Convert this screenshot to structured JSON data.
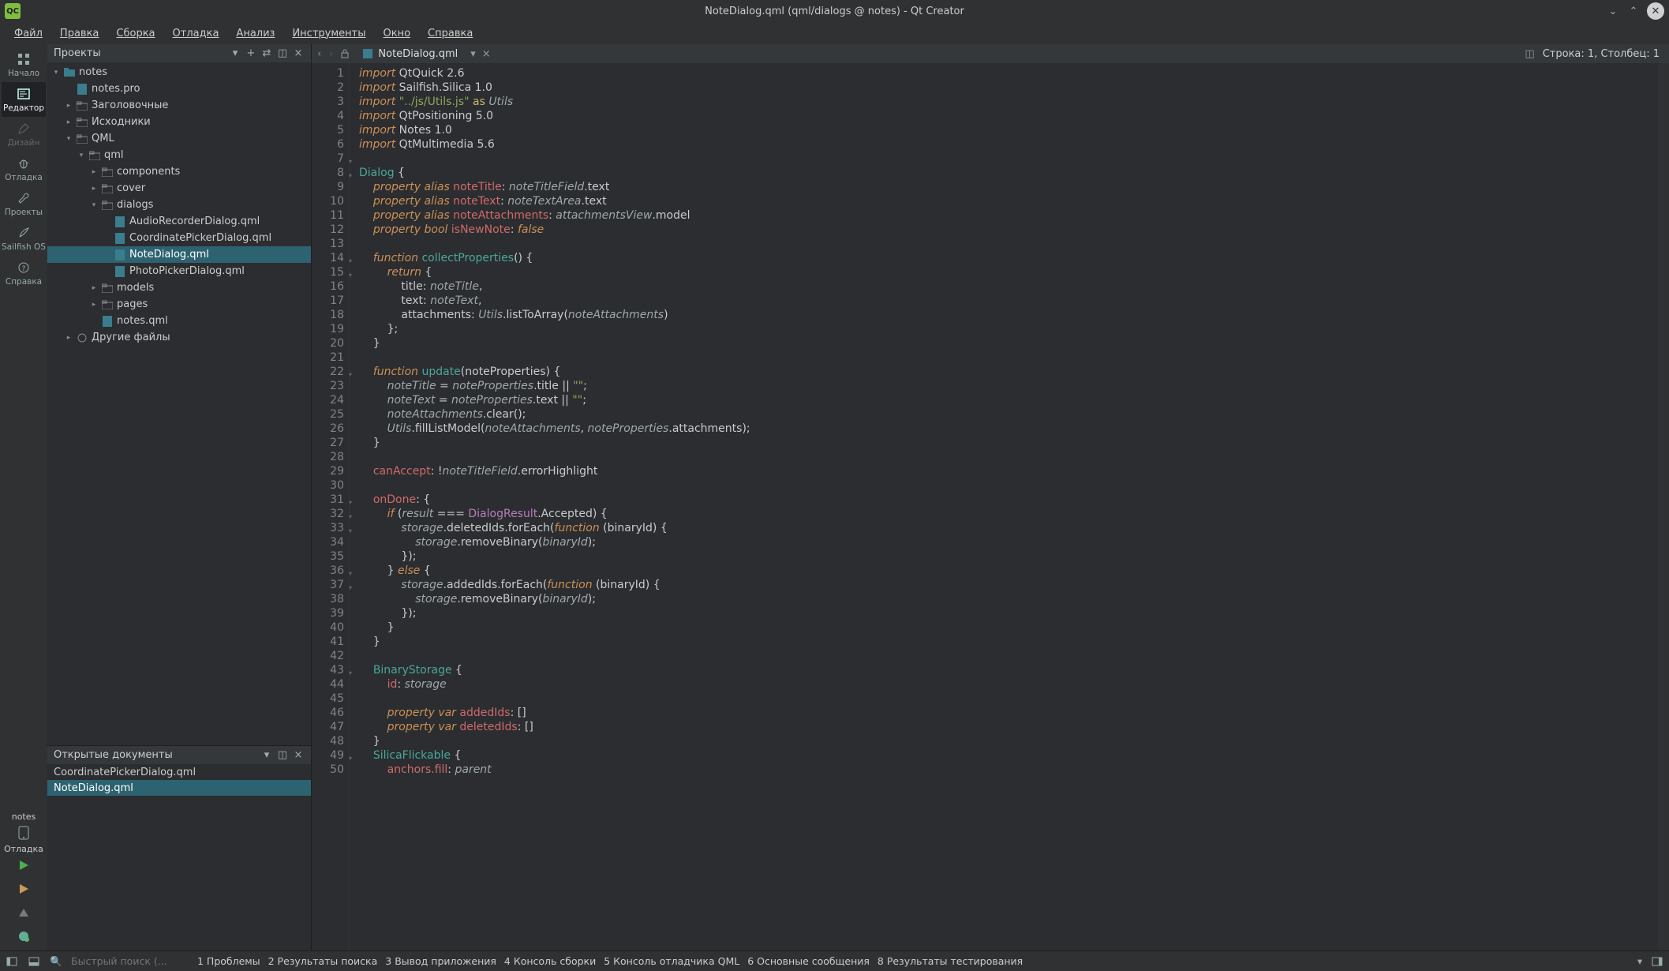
{
  "title": "NoteDialog.qml (qml/dialogs @ notes) - Qt Creator",
  "app_icon_text": "QC",
  "menu": {
    "file": "Файл",
    "edit": "Правка",
    "build": "Сборка",
    "debug": "Отладка",
    "analyze": "Анализ",
    "tools": "Инструменты",
    "window": "Окно",
    "help": "Справка"
  },
  "modes": {
    "start": "Начало",
    "edit": "Редактор",
    "design": "Дизайн",
    "debug": "Отладка",
    "projects": "Проекты",
    "sailfish": "Sailfish OS",
    "help": "Справка"
  },
  "kit": {
    "project": "notes",
    "config": "Отладка"
  },
  "projects_header": "Проекты",
  "opendocs_header": "Открытые документы",
  "tree": [
    {
      "d": 0,
      "a": "▾",
      "i": "proj",
      "t": "notes"
    },
    {
      "d": 1,
      "a": "",
      "i": "pro",
      "t": "notes.pro"
    },
    {
      "d": 1,
      "a": "▸",
      "i": "fold",
      "t": "Заголовочные"
    },
    {
      "d": 1,
      "a": "▸",
      "i": "fold",
      "t": "Исходники"
    },
    {
      "d": 1,
      "a": "▾",
      "i": "fold",
      "t": "QML"
    },
    {
      "d": 2,
      "a": "▾",
      "i": "dir",
      "t": "qml"
    },
    {
      "d": 3,
      "a": "▸",
      "i": "dir",
      "t": "components"
    },
    {
      "d": 3,
      "a": "▸",
      "i": "dir",
      "t": "cover"
    },
    {
      "d": 3,
      "a": "▾",
      "i": "dir",
      "t": "dialogs"
    },
    {
      "d": 4,
      "a": "",
      "i": "qml",
      "t": "AudioRecorderDialog.qml"
    },
    {
      "d": 4,
      "a": "",
      "i": "qml",
      "t": "CoordinatePickerDialog.qml"
    },
    {
      "d": 4,
      "a": "",
      "i": "qml",
      "t": "NoteDialog.qml",
      "sel": true
    },
    {
      "d": 4,
      "a": "",
      "i": "qml",
      "t": "PhotoPickerDialog.qml"
    },
    {
      "d": 3,
      "a": "▸",
      "i": "dir",
      "t": "models"
    },
    {
      "d": 3,
      "a": "▸",
      "i": "dir",
      "t": "pages"
    },
    {
      "d": 3,
      "a": "",
      "i": "qml",
      "t": "notes.qml"
    },
    {
      "d": 1,
      "a": "▸",
      "i": "other",
      "t": "Другие файлы"
    }
  ],
  "open_docs": [
    {
      "t": "CoordinatePickerDialog.qml",
      "sel": false
    },
    {
      "t": "NoteDialog.qml",
      "sel": true
    }
  ],
  "editor": {
    "filename": "NoteDialog.qml",
    "cursor": "Строка: 1, Столбец: 1"
  },
  "status": {
    "search_placeholder": "Быстрый поиск (...",
    "panes": [
      "1 Проблемы",
      "2 Результаты поиска",
      "3 Вывод приложения",
      "4 Консоль сборки",
      "5 Консоль отладчика QML",
      "6 Основные сообщения",
      "8 Результаты тестирования"
    ]
  },
  "code_lines": [
    {
      "n": 1,
      "f": "",
      "html": "<span class='kw'>import</span> QtQuick 2.6"
    },
    {
      "n": 2,
      "f": "",
      "html": "<span class='kw'>import</span> Sailfish.Silica 1.0"
    },
    {
      "n": 3,
      "f": "",
      "html": "<span class='kw'>import</span> <span class='str'>\"../js/Utils.js\"</span> <span class='yel'>as</span> <span class='ident'>Utils</span>"
    },
    {
      "n": 4,
      "f": "",
      "html": "<span class='kw'>import</span> QtPositioning 5.0"
    },
    {
      "n": 5,
      "f": "",
      "html": "<span class='kw'>import</span> Notes 1.0"
    },
    {
      "n": 6,
      "f": "",
      "html": "<span class='kw'>import</span> QtMultimedia 5.6"
    },
    {
      "n": 7,
      "f": "▾",
      "html": ""
    },
    {
      "n": 8,
      "f": "▾",
      "html": "<span class='type'>Dialog</span> {"
    },
    {
      "n": 9,
      "f": "",
      "html": "    <span class='kw'>property</span> <span class='kw'>alias</span> <span class='name'>noteTitle</span>: <span class='ident'>noteTitleField</span>.text"
    },
    {
      "n": 10,
      "f": "",
      "html": "    <span class='kw'>property</span> <span class='kw'>alias</span> <span class='name'>noteText</span>: <span class='ident'>noteTextArea</span>.text"
    },
    {
      "n": 11,
      "f": "",
      "html": "    <span class='kw'>property</span> <span class='kw'>alias</span> <span class='name'>noteAttachments</span>: <span class='ident'>attachmentsView</span>.model"
    },
    {
      "n": 12,
      "f": "",
      "html": "    <span class='kw'>property</span> <span class='kw'>bool</span> <span class='name'>isNewNote</span>: <span class='bool'>false</span>"
    },
    {
      "n": 13,
      "f": "",
      "html": ""
    },
    {
      "n": 14,
      "f": "▾",
      "html": "    <span class='kw'>function</span> <span class='fn'>collectProperties</span>() {"
    },
    {
      "n": 15,
      "f": "▾",
      "html": "        <span class='kw'>return</span> {"
    },
    {
      "n": 16,
      "f": "",
      "html": "            title: <span class='ident'>noteTitle</span>,"
    },
    {
      "n": 17,
      "f": "",
      "html": "            text: <span class='ident'>noteText</span>,"
    },
    {
      "n": 18,
      "f": "",
      "html": "            attachments: <span class='ident'>Utils</span>.listToArray(<span class='ident'>noteAttachments</span>)"
    },
    {
      "n": 19,
      "f": "",
      "html": "        };"
    },
    {
      "n": 20,
      "f": "",
      "html": "    }"
    },
    {
      "n": 21,
      "f": "",
      "html": ""
    },
    {
      "n": 22,
      "f": "▾",
      "html": "    <span class='kw'>function</span> <span class='fn'>update</span>(noteProperties) {"
    },
    {
      "n": 23,
      "f": "",
      "html": "        <span class='ident'>noteTitle</span> = <span class='ident'>noteProperties</span>.title || <span class='str'>\"\"</span>;"
    },
    {
      "n": 24,
      "f": "",
      "html": "        <span class='ident'>noteText</span> = <span class='ident'>noteProperties</span>.text || <span class='str'>\"\"</span>;"
    },
    {
      "n": 25,
      "f": "",
      "html": "        <span class='ident'>noteAttachments</span>.clear();"
    },
    {
      "n": 26,
      "f": "",
      "html": "        <span class='ident'>Utils</span>.fillListModel(<span class='ident'>noteAttachments</span>, <span class='ident'>noteProperties</span>.attachments);"
    },
    {
      "n": 27,
      "f": "",
      "html": "    }"
    },
    {
      "n": 28,
      "f": "",
      "html": ""
    },
    {
      "n": 29,
      "f": "",
      "html": "    <span class='name'>canAccept</span>: !<span class='ident'>noteTitleField</span>.errorHighlight"
    },
    {
      "n": 30,
      "f": "",
      "html": ""
    },
    {
      "n": 31,
      "f": "▾",
      "html": "    <span class='name'>onDone</span>: {"
    },
    {
      "n": 32,
      "f": "▾",
      "html": "        <span class='kw'>if</span> (<span class='ident'>result</span> === <span class='mag'>DialogResult</span>.Accepted) {"
    },
    {
      "n": 33,
      "f": "▾",
      "html": "            <span class='ident'>storage</span>.deletedIds.forEach(<span class='kw'>function</span> (binaryId) {"
    },
    {
      "n": 34,
      "f": "",
      "html": "                <span class='ident'>storage</span>.removeBinary(<span class='ident'>binaryId</span>);"
    },
    {
      "n": 35,
      "f": "",
      "html": "            });"
    },
    {
      "n": 36,
      "f": "▾",
      "html": "        } <span class='kw'>else</span> {"
    },
    {
      "n": 37,
      "f": "▾",
      "html": "            <span class='ident'>storage</span>.addedIds.forEach(<span class='kw'>function</span> (binaryId) {"
    },
    {
      "n": 38,
      "f": "",
      "html": "                <span class='ident'>storage</span>.removeBinary(<span class='ident'>binaryId</span>);"
    },
    {
      "n": 39,
      "f": "",
      "html": "            });"
    },
    {
      "n": 40,
      "f": "",
      "html": "        }"
    },
    {
      "n": 41,
      "f": "",
      "html": "    }"
    },
    {
      "n": 42,
      "f": "",
      "html": ""
    },
    {
      "n": 43,
      "f": "▾",
      "html": "    <span class='type'>BinaryStorage</span> {"
    },
    {
      "n": 44,
      "f": "",
      "html": "        <span class='name'>id</span>: <span class='ident'>storage</span>"
    },
    {
      "n": 45,
      "f": "",
      "html": ""
    },
    {
      "n": 46,
      "f": "",
      "html": "        <span class='kw'>property</span> <span class='kw'>var</span> <span class='name'>addedIds</span>: []"
    },
    {
      "n": 47,
      "f": "",
      "html": "        <span class='kw'>property</span> <span class='kw'>var</span> <span class='name'>deletedIds</span>: []"
    },
    {
      "n": 48,
      "f": "",
      "html": "    }"
    },
    {
      "n": 49,
      "f": "▾",
      "html": "    <span class='type'>SilicaFlickable</span> {"
    },
    {
      "n": 50,
      "f": "",
      "html": "        <span class='name'>anchors.fill</span>: <span class='ident'>parent</span>"
    }
  ]
}
